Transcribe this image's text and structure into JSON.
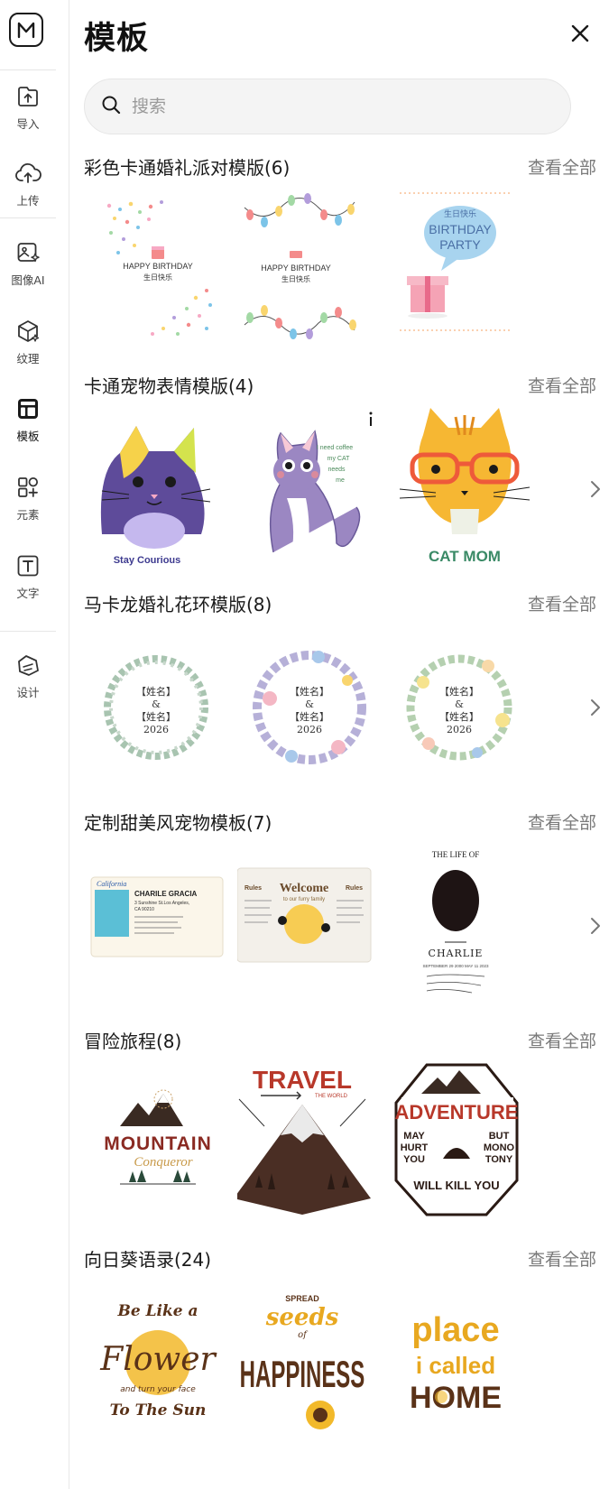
{
  "header": {
    "title": "模板"
  },
  "search": {
    "placeholder": "搜索"
  },
  "sidebar": {
    "items": [
      {
        "label": "导入",
        "icon": "import-icon"
      },
      {
        "label": "上传",
        "icon": "cloud-upload-icon"
      },
      {
        "label": "图像AI",
        "icon": "image-ai-icon"
      },
      {
        "label": "纹理",
        "icon": "texture-icon"
      },
      {
        "label": "模板",
        "icon": "template-icon",
        "active": true
      },
      {
        "label": "元素",
        "icon": "elements-icon"
      },
      {
        "label": "文字",
        "icon": "text-icon"
      },
      {
        "label": "设计",
        "icon": "design-icon"
      }
    ]
  },
  "sections": [
    {
      "title": "彩色卡通婚礼派对模版(6)",
      "view_all": "查看全部",
      "thumbs": [
        {
          "lines": [
            "HAPPY BIRTHDAY",
            "生日快乐"
          ]
        },
        {
          "lines": [
            "HAPPY BIRTHDAY",
            "生日快乐"
          ]
        },
        {
          "lines": [
            "生日快乐",
            "BIRTHDAY",
            "PARTY"
          ]
        }
      ]
    },
    {
      "title": "卡通宠物表情模版(4)",
      "view_all": "查看全部",
      "thumbs": [
        {
          "lines": [
            "Stay Courious"
          ]
        },
        {
          "lines": [
            "I need coffee",
            "my CAT",
            "needs",
            "me"
          ]
        },
        {
          "lines": [
            "CAT MOM"
          ]
        }
      ]
    },
    {
      "title": "马卡龙婚礼花环模版(8)",
      "view_all": "查看全部",
      "thumbs": [
        {
          "lines": [
            "【姓名】",
            "&",
            "【姓名】",
            "2026"
          ]
        },
        {
          "lines": [
            "【姓名】",
            "&",
            "【姓名】",
            "2026"
          ]
        },
        {
          "lines": [
            "【姓名】",
            "&",
            "【姓名】",
            "2026"
          ]
        }
      ]
    },
    {
      "title": "定制甜美风宠物模板(7)",
      "view_all": "查看全部",
      "thumbs": [
        {
          "lines": [
            "California",
            "CHARILE GRACIA",
            "3 Sunshine St.Los Angeles,",
            "CA 90210"
          ]
        },
        {
          "lines": [
            "Welcome",
            "to our furry family",
            "Rules",
            "Rules"
          ]
        },
        {
          "lines": [
            "THE LIFE OF",
            "CHARLIE",
            "SEPTEMBER 29 2000 MAY 11 2023"
          ]
        }
      ]
    },
    {
      "title": "冒险旅程(8)",
      "view_all": "查看全部",
      "thumbs": [
        {
          "lines": [
            "MOUNTAIN",
            "Conqueror"
          ]
        },
        {
          "lines": [
            "TRAVEL",
            "THE WORLD"
          ]
        },
        {
          "lines": [
            "ADVENTURE",
            "MAY",
            "HURT",
            "YOU",
            "BUT",
            "MONO",
            "TONY",
            "WILL KILL YOU"
          ]
        }
      ]
    },
    {
      "title": "向日葵语录(24)",
      "view_all": "查看全部",
      "thumbs": [
        {
          "lines": [
            "Be Like a",
            "Flower",
            "and turn your face",
            "To The Sun"
          ]
        },
        {
          "lines": [
            "SPREAD",
            "seeds",
            "of",
            "HAPPINESS"
          ]
        },
        {
          "lines": [
            "place",
            "i called",
            "HOME"
          ]
        }
      ]
    }
  ]
}
